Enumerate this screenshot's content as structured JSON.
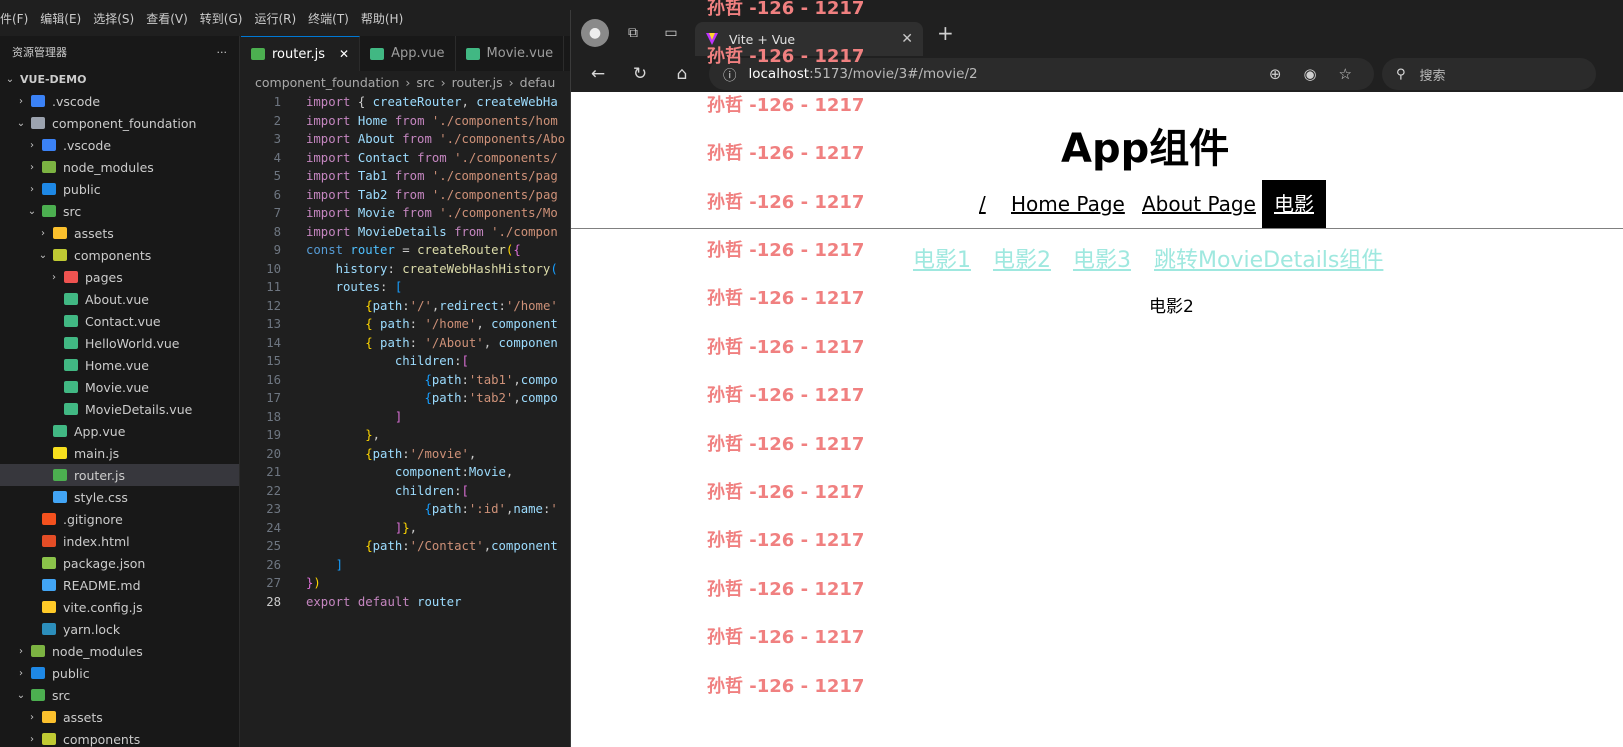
{
  "vscode": {
    "menu": [
      "件(F)",
      "编辑(E)",
      "选择(S)",
      "查看(V)",
      "转到(G)",
      "运行(R)",
      "终端(T)",
      "帮助(H)"
    ],
    "explorer_title": "资源管理器",
    "explorer_more": "···",
    "tree": [
      {
        "label": "VUE-DEMO",
        "depth": 0,
        "chev": "⌄",
        "icon": "none",
        "icon_color": "",
        "root": true
      },
      {
        "label": ".vscode",
        "depth": 1,
        "chev": "›",
        "icon": "folder-vscode-icon",
        "icon_color": "#3b82f6"
      },
      {
        "label": "component_foundation",
        "depth": 1,
        "chev": "⌄",
        "icon": "folder-open-icon",
        "icon_color": "#9ca3af"
      },
      {
        "label": ".vscode",
        "depth": 2,
        "chev": "›",
        "icon": "folder-vscode-icon",
        "icon_color": "#3b82f6"
      },
      {
        "label": "node_modules",
        "depth": 2,
        "chev": "›",
        "icon": "folder-node-icon",
        "icon_color": "#7cb342"
      },
      {
        "label": "public",
        "depth": 2,
        "chev": "›",
        "icon": "folder-public-icon",
        "icon_color": "#1e88e5"
      },
      {
        "label": "src",
        "depth": 2,
        "chev": "⌄",
        "icon": "folder-src-icon",
        "icon_color": "#4caf50"
      },
      {
        "label": "assets",
        "depth": 3,
        "chev": "›",
        "icon": "folder-assets-icon",
        "icon_color": "#fbc02d"
      },
      {
        "label": "components",
        "depth": 3,
        "chev": "⌄",
        "icon": "folder-components-icon",
        "icon_color": "#c0ca33"
      },
      {
        "label": "pages",
        "depth": 4,
        "chev": "›",
        "icon": "folder-pages-icon",
        "icon_color": "#ef5350"
      },
      {
        "label": "About.vue",
        "depth": 4,
        "chev": "",
        "icon": "vue-icon",
        "icon_color": "#41b883"
      },
      {
        "label": "Contact.vue",
        "depth": 4,
        "chev": "",
        "icon": "vue-icon",
        "icon_color": "#41b883"
      },
      {
        "label": "HelloWorld.vue",
        "depth": 4,
        "chev": "",
        "icon": "vue-icon",
        "icon_color": "#41b883"
      },
      {
        "label": "Home.vue",
        "depth": 4,
        "chev": "",
        "icon": "vue-icon",
        "icon_color": "#41b883"
      },
      {
        "label": "Movie.vue",
        "depth": 4,
        "chev": "",
        "icon": "vue-icon",
        "icon_color": "#41b883"
      },
      {
        "label": "MovieDetails.vue",
        "depth": 4,
        "chev": "",
        "icon": "vue-icon",
        "icon_color": "#41b883"
      },
      {
        "label": "App.vue",
        "depth": 3,
        "chev": "",
        "icon": "vue-icon",
        "icon_color": "#41b883"
      },
      {
        "label": "main.js",
        "depth": 3,
        "chev": "",
        "icon": "js-icon",
        "icon_color": "#f7df1e"
      },
      {
        "label": "router.js",
        "depth": 3,
        "chev": "",
        "icon": "router-icon",
        "icon_color": "#4caf50",
        "active": true
      },
      {
        "label": "style.css",
        "depth": 3,
        "chev": "",
        "icon": "css-icon",
        "icon_color": "#42a5f5"
      },
      {
        "label": ".gitignore",
        "depth": 2,
        "chev": "",
        "icon": "git-icon",
        "icon_color": "#f4511e"
      },
      {
        "label": "index.html",
        "depth": 2,
        "chev": "",
        "icon": "html-icon",
        "icon_color": "#e44d26"
      },
      {
        "label": "package.json",
        "depth": 2,
        "chev": "",
        "icon": "nodejs-icon",
        "icon_color": "#8bc34a"
      },
      {
        "label": "README.md",
        "depth": 2,
        "chev": "",
        "icon": "info-icon",
        "icon_color": "#42a5f5"
      },
      {
        "label": "vite.config.js",
        "depth": 2,
        "chev": "",
        "icon": "vite-icon",
        "icon_color": "#ffca28"
      },
      {
        "label": "yarn.lock",
        "depth": 2,
        "chev": "",
        "icon": "yarn-icon",
        "icon_color": "#2c8ebb"
      },
      {
        "label": "node_modules",
        "depth": 1,
        "chev": "›",
        "icon": "folder-node-icon",
        "icon_color": "#7cb342"
      },
      {
        "label": "public",
        "depth": 1,
        "chev": "›",
        "icon": "folder-public-icon",
        "icon_color": "#1e88e5"
      },
      {
        "label": "src",
        "depth": 1,
        "chev": "⌄",
        "icon": "folder-src-icon",
        "icon_color": "#4caf50"
      },
      {
        "label": "assets",
        "depth": 2,
        "chev": "›",
        "icon": "folder-assets-icon",
        "icon_color": "#fbc02d"
      },
      {
        "label": "components",
        "depth": 2,
        "chev": "›",
        "icon": "folder-components-icon",
        "icon_color": "#c0ca33"
      }
    ],
    "tabs": [
      {
        "label": "router.js",
        "icon": "router-icon",
        "icon_color": "#4caf50",
        "active": true,
        "close": "✕"
      },
      {
        "label": "App.vue",
        "icon": "vue-icon",
        "icon_color": "#41b883",
        "active": false,
        "close": ""
      },
      {
        "label": "Movie.vue",
        "icon": "vue-icon",
        "icon_color": "#41b883",
        "active": false,
        "close": ""
      }
    ],
    "breadcrumb": [
      "component_foundation",
      "src",
      "router.js",
      "defau"
    ],
    "breadcrumb_sep": "›",
    "current_line": 28,
    "code_lines": [
      [
        [
          "k",
          "import "
        ],
        [
          "p",
          "{ "
        ],
        [
          "v",
          "createRouter"
        ],
        [
          "p",
          ", "
        ],
        [
          "v",
          "createWebHa"
        ]
      ],
      [
        [
          "k",
          "import "
        ],
        [
          "v",
          "Home "
        ],
        [
          "k",
          "from "
        ],
        [
          "s",
          "'./components/hom"
        ]
      ],
      [
        [
          "k",
          "import "
        ],
        [
          "v",
          "About "
        ],
        [
          "k",
          "from "
        ],
        [
          "s",
          "'./components/Abo"
        ]
      ],
      [
        [
          "k",
          "import "
        ],
        [
          "v",
          "Contact "
        ],
        [
          "k",
          "from "
        ],
        [
          "s",
          "'./components/"
        ]
      ],
      [
        [
          "k",
          "import "
        ],
        [
          "v",
          "Tab1 "
        ],
        [
          "k",
          "from "
        ],
        [
          "s",
          "'./components/pag"
        ]
      ],
      [
        [
          "k",
          "import "
        ],
        [
          "v",
          "Tab2 "
        ],
        [
          "k",
          "from "
        ],
        [
          "s",
          "'./components/pag"
        ]
      ],
      [
        [
          "k",
          "import "
        ],
        [
          "v",
          "Movie "
        ],
        [
          "k",
          "from "
        ],
        [
          "s",
          "'./components/Mo"
        ]
      ],
      [
        [
          "k",
          "import "
        ],
        [
          "v",
          "MovieDetails "
        ],
        [
          "k",
          "from "
        ],
        [
          "s",
          "'./compon"
        ]
      ],
      [
        [
          "kw",
          "const "
        ],
        [
          "c",
          "router "
        ],
        [
          "p",
          "= "
        ],
        [
          "f",
          "createRouter"
        ],
        [
          "b1",
          "("
        ],
        [
          "b2",
          "{"
        ]
      ],
      [
        [
          "p",
          "    "
        ],
        [
          "v",
          "history"
        ],
        [
          "p",
          ": "
        ],
        [
          "f",
          "createWebHashHistory"
        ],
        [
          "b3",
          "("
        ]
      ],
      [
        [
          "p",
          "    "
        ],
        [
          "v",
          "routes"
        ],
        [
          "p",
          ": "
        ],
        [
          "b3",
          "["
        ]
      ],
      [
        [
          "p",
          "        "
        ],
        [
          "b1",
          "{"
        ],
        [
          "v",
          "path"
        ],
        [
          "p",
          ":"
        ],
        [
          "s",
          "'/'"
        ],
        [
          "p",
          ","
        ],
        [
          "v",
          "redirect"
        ],
        [
          "p",
          ":"
        ],
        [
          "s",
          "'/home'"
        ]
      ],
      [
        [
          "p",
          "        "
        ],
        [
          "b1",
          "{ "
        ],
        [
          "v",
          "path"
        ],
        [
          "p",
          ": "
        ],
        [
          "s",
          "'/home'"
        ],
        [
          "p",
          ", "
        ],
        [
          "v",
          "component"
        ]
      ],
      [
        [
          "p",
          "        "
        ],
        [
          "b1",
          "{ "
        ],
        [
          "v",
          "path"
        ],
        [
          "p",
          ": "
        ],
        [
          "s",
          "'/About'"
        ],
        [
          "p",
          ", "
        ],
        [
          "v",
          "componen"
        ]
      ],
      [
        [
          "p",
          "            "
        ],
        [
          "v",
          "children"
        ],
        [
          "p",
          ":"
        ],
        [
          "b2",
          "["
        ]
      ],
      [
        [
          "p",
          "                "
        ],
        [
          "b3",
          "{"
        ],
        [
          "v",
          "path"
        ],
        [
          "p",
          ":"
        ],
        [
          "s",
          "'tab1'"
        ],
        [
          "p",
          ","
        ],
        [
          "v",
          "compo"
        ]
      ],
      [
        [
          "p",
          "                "
        ],
        [
          "b3",
          "{"
        ],
        [
          "v",
          "path"
        ],
        [
          "p",
          ":"
        ],
        [
          "s",
          "'tab2'"
        ],
        [
          "p",
          ","
        ],
        [
          "v",
          "compo"
        ]
      ],
      [
        [
          "p",
          "            "
        ],
        [
          "b2",
          "]"
        ]
      ],
      [
        [
          "p",
          "        "
        ],
        [
          "b1",
          "}"
        ],
        [
          "p",
          ","
        ]
      ],
      [
        [
          "p",
          "        "
        ],
        [
          "b1",
          "{"
        ],
        [
          "v",
          "path"
        ],
        [
          "p",
          ":"
        ],
        [
          "s",
          "'/movie'"
        ],
        [
          "p",
          ","
        ]
      ],
      [
        [
          "p",
          "            "
        ],
        [
          "v",
          "component"
        ],
        [
          "p",
          ":"
        ],
        [
          "v",
          "Movie"
        ],
        [
          "p",
          ","
        ]
      ],
      [
        [
          "p",
          "            "
        ],
        [
          "v",
          "children"
        ],
        [
          "p",
          ":"
        ],
        [
          "b2",
          "["
        ]
      ],
      [
        [
          "p",
          "                "
        ],
        [
          "b3",
          "{"
        ],
        [
          "v",
          "path"
        ],
        [
          "p",
          ":"
        ],
        [
          "s",
          "':id'"
        ],
        [
          "p",
          ","
        ],
        [
          "v",
          "name"
        ],
        [
          "p",
          ":"
        ],
        [
          "s",
          "'"
        ]
      ],
      [
        [
          "p",
          "            "
        ],
        [
          "b2",
          "]"
        ],
        [
          "b1",
          "}"
        ],
        [
          "p",
          ","
        ]
      ],
      [
        [
          "p",
          "        "
        ],
        [
          "b1",
          "{"
        ],
        [
          "v",
          "path"
        ],
        [
          "p",
          ":"
        ],
        [
          "s",
          "'/Contact'"
        ],
        [
          "p",
          ","
        ],
        [
          "v",
          "component"
        ]
      ],
      [
        [
          "p",
          "    "
        ],
        [
          "b3",
          "]"
        ]
      ],
      [
        [
          "b2",
          "}"
        ],
        [
          "b1",
          ")"
        ]
      ],
      [
        [
          "k",
          "export "
        ],
        [
          "k",
          "default "
        ],
        [
          "v",
          "router"
        ]
      ]
    ]
  },
  "browser": {
    "tab_title": "Vite + Vue",
    "tab_close": "✕",
    "new_tab": "+",
    "url_host": "localhost",
    "url_rest": ":5173/movie/3#/movie/2",
    "search_placeholder": "搜索",
    "app_title": "App组件",
    "nav_links": [
      {
        "label": "/",
        "selected": false
      },
      {
        "label": "Home Page",
        "selected": false
      },
      {
        "label": "About Page",
        "selected": false
      },
      {
        "label": "电影",
        "selected": true
      }
    ],
    "movie_links": [
      "电影1",
      "电影2",
      "电影3",
      "跳转MovieDetails组件"
    ],
    "content_text": "电影2",
    "colors": {
      "link_visited": "#9fe8df",
      "watermark": "#f08080",
      "nav_selected_bg": "#000000"
    }
  },
  "watermark": {
    "text": "孙哲 -126 - 1217",
    "count": 15
  }
}
